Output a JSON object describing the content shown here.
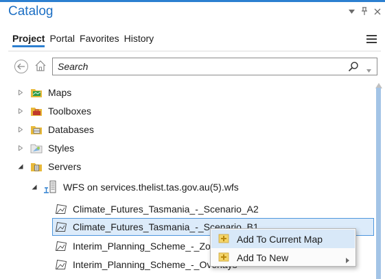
{
  "pane": {
    "title": "Catalog",
    "controls": {
      "menu": "▾",
      "pin": "ᵖ",
      "close": "×"
    }
  },
  "tabs": [
    {
      "label": "Project",
      "active": true
    },
    {
      "label": "Portal",
      "active": false
    },
    {
      "label": "Favorites",
      "active": false
    },
    {
      "label": "History",
      "active": false
    }
  ],
  "search": {
    "placeholder": "Search",
    "value": ""
  },
  "tree": {
    "items": [
      {
        "label": "Maps",
        "icon": "maps-folder-icon",
        "state": "collapsed"
      },
      {
        "label": "Toolboxes",
        "icon": "toolboxes-folder-icon",
        "state": "collapsed"
      },
      {
        "label": "Databases",
        "icon": "databases-folder-icon",
        "state": "collapsed"
      },
      {
        "label": "Styles",
        "icon": "styles-folder-icon",
        "state": "collapsed"
      },
      {
        "label": "Servers",
        "icon": "servers-folder-icon",
        "state": "expanded"
      }
    ],
    "server": {
      "label": "WFS on services.thelist.tas.gov.au(5).wfs",
      "icon": "wfs-server-icon",
      "state": "expanded"
    },
    "layers": [
      {
        "label": "Climate_Futures_Tasmania_-_Scenario_A2",
        "icon": "polygon-layer-icon",
        "selected": false
      },
      {
        "label": "Climate_Futures_Tasmania_-_Scenario_B1",
        "icon": "polygon-layer-icon",
        "selected": true
      },
      {
        "label": "Interim_Planning_Scheme_-_Zones",
        "icon": "polygon-layer-icon",
        "selected": false
      },
      {
        "label": "Interim_Planning_Scheme_-_Overlays",
        "icon": "polygon-layer-icon",
        "selected": false
      }
    ]
  },
  "context_menu": {
    "items": [
      {
        "label": "Add To Current Map",
        "icon": "add-layer-icon",
        "hover": true,
        "submenu": false
      },
      {
        "label": "Add To New",
        "icon": "add-layer-icon",
        "hover": false,
        "submenu": true
      }
    ]
  },
  "colors": {
    "accent": "#2c7fd0",
    "title": "#1c6fc4",
    "selection_bg": "#dcebfa",
    "selection_border": "#4c95dc",
    "scroll_thumb": "#a3c4e6",
    "folder_yellow": "#e8b93a"
  }
}
